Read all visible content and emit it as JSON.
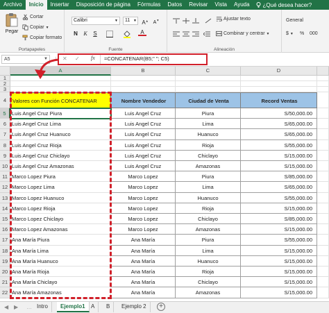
{
  "menu": {
    "items": [
      "Archivo",
      "Inicio",
      "Insertar",
      "Disposición de página",
      "Fórmulas",
      "Datos",
      "Revisar",
      "Vista",
      "Ayuda"
    ],
    "active_index": 1,
    "help_prompt": "¿Qué desea hacer?"
  },
  "ribbon": {
    "paste_label": "Pegar",
    "cut_label": "Cortar",
    "copy_label": "Copiar",
    "format_painter_label": "Copiar formato",
    "clipboard_group": "Portapapeles",
    "font_name": "Calibri",
    "font_size": "11",
    "font_group": "Fuente",
    "bold": "N",
    "italic": "K",
    "underline": "S",
    "wrap_text_label": "Ajustar texto",
    "merge_center_label": "Combinar y centrar",
    "alignment_group": "Alineación",
    "number_format": "General",
    "currency_symbol": "$",
    "percent_symbol": "%",
    "thousands_symbol": "000"
  },
  "formula_bar": {
    "name_box": "A5",
    "cancel": "✕",
    "enter": "✓",
    "fx": "fx",
    "formula": "=CONCATENAR(B5;\" \"; C5)"
  },
  "columns": [
    "A",
    "B",
    "C",
    "D"
  ],
  "row_numbers": [
    "1",
    "2",
    "3",
    "4",
    "5",
    "6",
    "7",
    "8",
    "9",
    "10",
    "11",
    "12",
    "13",
    "14",
    "15",
    "16",
    "17",
    "18",
    "19",
    "20",
    "21",
    "22"
  ],
  "headers": {
    "concat": "Valores con Función CONCATENAR",
    "vendor": "Nombre Vendedor",
    "city": "Ciudad de Venta",
    "record": "Record Ventas"
  },
  "rows": [
    {
      "concat": "Luis Angel Cruz Piura",
      "vendor": "Luis Angel Cruz",
      "city": "Piura",
      "record": "S/50,000.00"
    },
    {
      "concat": "Luis Angel Cruz Lima",
      "vendor": "Luis Angel Cruz",
      "city": "Lima",
      "record": "S/65,000.00"
    },
    {
      "concat": "Luis Angel Cruz Huanuco",
      "vendor": "Luis Angel Cruz",
      "city": "Huanuco",
      "record": "S/65,000.00"
    },
    {
      "concat": "Luis Angel Cruz Rioja",
      "vendor": "Luis Angel Cruz",
      "city": "Rioja",
      "record": "S/55,000.00"
    },
    {
      "concat": "Luis Angel Cruz Chiclayo",
      "vendor": "Luis Angel Cruz",
      "city": "Chiclayo",
      "record": "S/15,000.00"
    },
    {
      "concat": "Luis Angel Cruz Amazonas",
      "vendor": "Luis Angel Cruz",
      "city": "Amazonas",
      "record": "S/15,000.00"
    },
    {
      "concat": "Marco Lopez Piura",
      "vendor": "Marco Lopez",
      "city": "Piura",
      "record": "S/85,000.00"
    },
    {
      "concat": "Marco Lopez Lima",
      "vendor": "Marco Lopez",
      "city": "Lima",
      "record": "S/65,000.00"
    },
    {
      "concat": "Marco Lopez Huanuco",
      "vendor": "Marco Lopez",
      "city": "Huanuco",
      "record": "S/55,000.00"
    },
    {
      "concat": "Marco Lopez Rioja",
      "vendor": "Marco Lopez",
      "city": "Rioja",
      "record": "S/15,000.00"
    },
    {
      "concat": "Marco Lopez Chiclayo",
      "vendor": "Marco Lopez",
      "city": "Chiclayo",
      "record": "S/85,000.00"
    },
    {
      "concat": "Marco Lopez Amazonas",
      "vendor": "Marco Lopez",
      "city": "Amazonas",
      "record": "S/15,000.00"
    },
    {
      "concat": "Ana María Piura",
      "vendor": "Ana María",
      "city": "Piura",
      "record": "S/55,000.00"
    },
    {
      "concat": "Ana María Lima",
      "vendor": "Ana María",
      "city": "Lima",
      "record": "S/15,000.00"
    },
    {
      "concat": "Ana María Huanuco",
      "vendor": "Ana María",
      "city": "Huanuco",
      "record": "S/15,000.00"
    },
    {
      "concat": "Ana María Rioja",
      "vendor": "Ana María",
      "city": "Rioja",
      "record": "S/15,000.00"
    },
    {
      "concat": "Ana María Chiclayo",
      "vendor": "Ana María",
      "city": "Chiclayo",
      "record": "S/15,000.00"
    },
    {
      "concat": "Ana María Amazonas",
      "vendor": "Ana María",
      "city": "Amazonas",
      "record": "S/15,000.00"
    }
  ],
  "sheet_tabs": [
    "Intro",
    "Ejemplo1",
    "A",
    "B",
    "Ejemplo 2"
  ],
  "active_sheet_index": 1,
  "colors": {
    "excel_green": "#217346",
    "header_blue": "#9dc3e6",
    "highlight_yellow": "#ffff00",
    "annotation_red": "#d1202a"
  }
}
